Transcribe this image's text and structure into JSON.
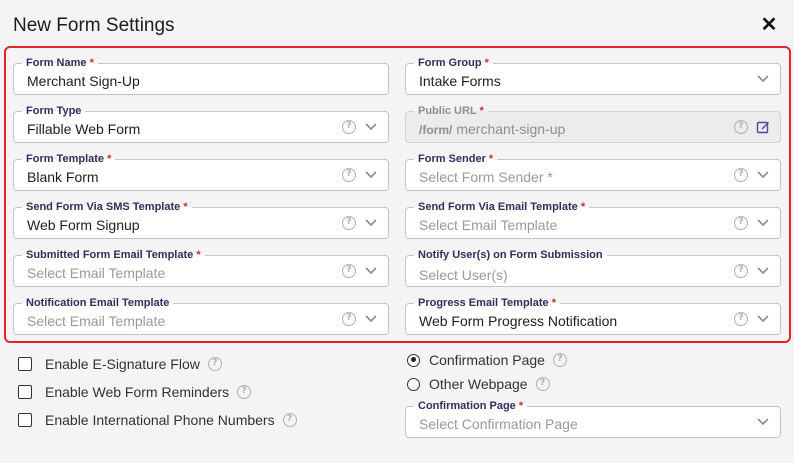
{
  "dialog": {
    "title": "New Form Settings",
    "close_icon": "close-icon"
  },
  "fields": {
    "form_name": {
      "label": "Form Name",
      "required": "*",
      "value": "Merchant Sign-Up"
    },
    "form_group": {
      "label": "Form Group",
      "required": "*",
      "value": "Intake Forms"
    },
    "form_type": {
      "label": "Form Type",
      "value": "Fillable Web Form"
    },
    "public_url": {
      "label": "Public URL",
      "required": "*",
      "prefix": "/form/",
      "value": "merchant-sign-up"
    },
    "form_template": {
      "label": "Form Template",
      "required": "*",
      "value": "Blank Form"
    },
    "form_sender": {
      "label": "Form Sender",
      "required": "*",
      "placeholder": "Select Form Sender *"
    },
    "sms_template": {
      "label": "Send Form Via SMS Template",
      "required": "*",
      "value": "Web Form Signup"
    },
    "email_template": {
      "label": "Send Form Via Email Template",
      "required": "*",
      "placeholder": "Select Email Template"
    },
    "submitted_email": {
      "label": "Submitted Form Email Template",
      "required": "*",
      "placeholder": "Select Email Template"
    },
    "notify_users": {
      "label": "Notify User(s) on Form Submission",
      "placeholder": "Select User(s)"
    },
    "notification_email": {
      "label": "Notification Email Template",
      "placeholder": "Select Email Template"
    },
    "progress_email": {
      "label": "Progress Email Template",
      "required": "*",
      "value": "Web Form Progress Notification"
    },
    "confirmation_page": {
      "label": "Confirmation Page",
      "required": "*",
      "placeholder": "Select Confirmation Page"
    }
  },
  "checkboxes": [
    {
      "label": "Enable E-Signature Flow",
      "checked": false
    },
    {
      "label": "Enable Web Form Reminders",
      "checked": false
    },
    {
      "label": "Enable International Phone Numbers",
      "checked": false
    }
  ],
  "radios": [
    {
      "label": "Confirmation Page",
      "selected": true
    },
    {
      "label": "Other Webpage",
      "selected": false
    }
  ],
  "help_glyph": "?",
  "colors": {
    "highlight_border": "#e0262b",
    "required_star": "#d9262b",
    "label_text": "#3a2a5e",
    "edit_icon": "#5b3fa0"
  }
}
